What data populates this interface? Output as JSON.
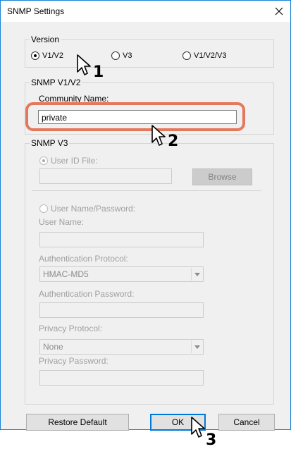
{
  "window": {
    "title": "SNMP Settings",
    "close_glyph": "×"
  },
  "version": {
    "label": "Version",
    "options": [
      {
        "label": "V1/V2",
        "selected": true
      },
      {
        "label": "V3",
        "selected": false
      },
      {
        "label": "V1/V2/V3",
        "selected": false
      }
    ]
  },
  "snmp_v1v2": {
    "label": "SNMP V1/V2",
    "community_label": "Community Name:",
    "community_value": "private"
  },
  "snmp_v3": {
    "label": "SNMP V3",
    "user_id_file_label": "User ID File:",
    "user_id_file_value": "",
    "browse_label": "Browse",
    "user_name_password_label": "User Name/Password:",
    "user_name_label": "User Name:",
    "user_name_value": "",
    "auth_protocol_label": "Authentication Protocol:",
    "auth_protocol_value": "HMAC-MD5",
    "auth_password_label": "Authentication Password:",
    "auth_password_value": "",
    "privacy_protocol_label": "Privacy Protocol:",
    "privacy_protocol_value": "None",
    "privacy_password_label": "Privacy Password:",
    "privacy_password_value": ""
  },
  "buttons": {
    "restore_default": "Restore Default",
    "ok": "OK",
    "cancel": "Cancel"
  },
  "callouts": {
    "step1": "1",
    "step2": "2",
    "step3": "3"
  },
  "colors": {
    "highlight": "#e4785d",
    "accent": "#0078d7"
  },
  "icons": {
    "close": "close-icon",
    "pointer": "pointer-cursor-icon",
    "dropdown": "chevron-down-icon"
  }
}
